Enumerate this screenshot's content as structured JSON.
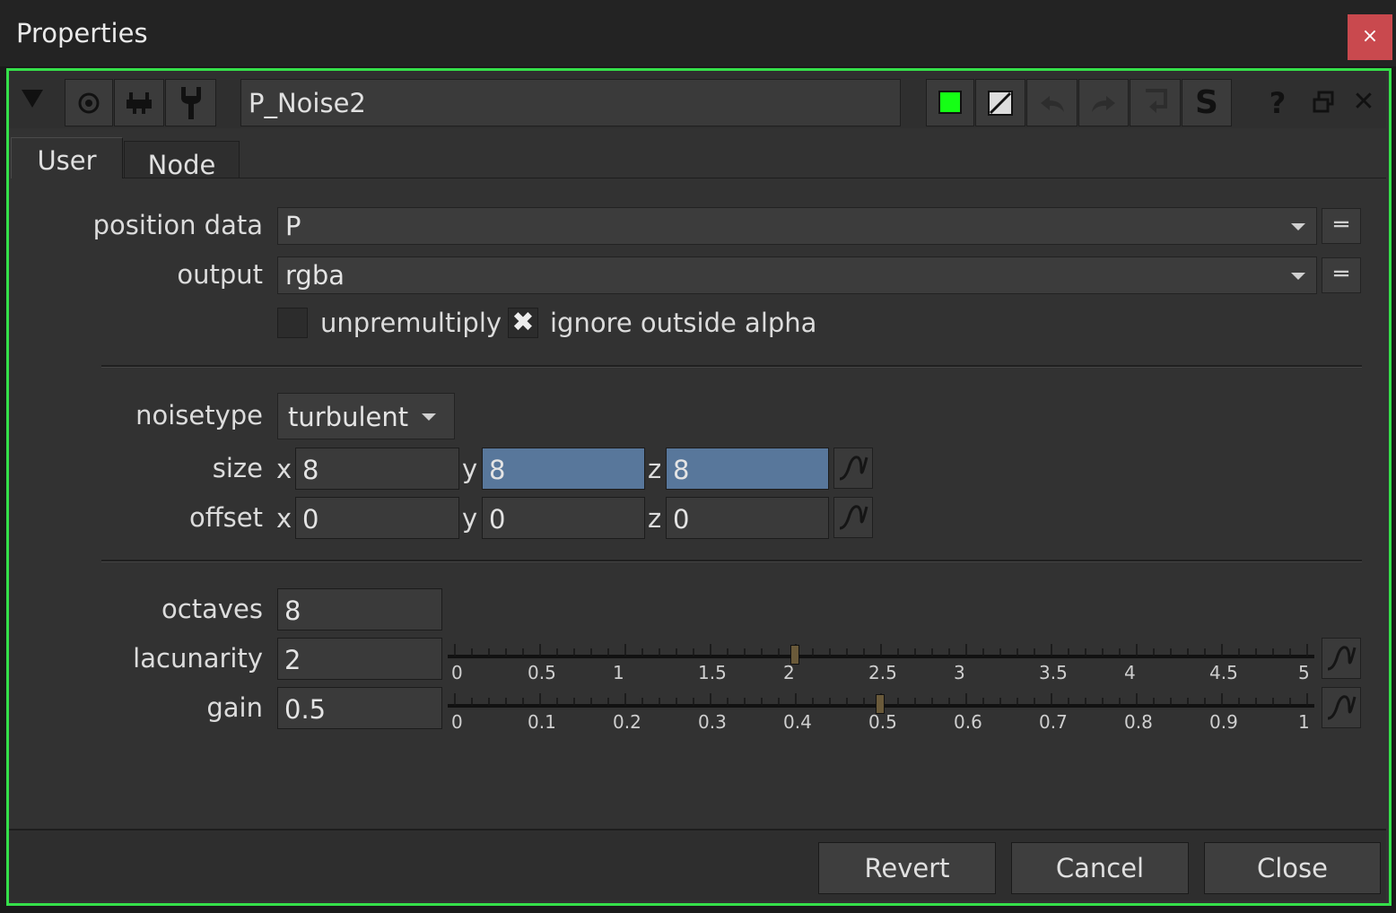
{
  "window": {
    "title": "Properties",
    "close_glyph": "×"
  },
  "toolbar": {
    "node_name": "P_Noise2",
    "icons": [
      "collapse-arrow-icon",
      "viewer-icon",
      "knob-icon",
      "wrench-icon",
      "green-color-swatch",
      "diagonal-swatch-icon",
      "undo-icon",
      "redo-icon",
      "revert-icon",
      "s-icon",
      "help-icon",
      "float-icon",
      "close-icon"
    ],
    "node_color": "#15ff15",
    "help_glyph": "?",
    "close_glyph": "✕",
    "s_glyph": "S"
  },
  "tabs": [
    {
      "label": "User"
    },
    {
      "label": "Node"
    }
  ],
  "form": {
    "position_data": {
      "label": "position data",
      "value": "P"
    },
    "output": {
      "label": "output",
      "value": "rgba"
    },
    "eq_glyph": "═",
    "unpremultiply": {
      "label": "unpremultiply",
      "checked": false
    },
    "ignore_outside_alpha": {
      "label": "ignore outside alpha",
      "checked": true,
      "glyph": "✖"
    },
    "noisetype": {
      "label": "noisetype",
      "value": "turbulent"
    },
    "size": {
      "label": "size",
      "x_label": "x",
      "y_label": "y",
      "z_label": "z",
      "x": "8",
      "y": "8",
      "z": "8"
    },
    "offset": {
      "label": "offset",
      "x_label": "x",
      "y_label": "y",
      "z_label": "z",
      "x": "0",
      "y": "0",
      "z": "0"
    },
    "octaves": {
      "label": "octaves",
      "value": "8"
    },
    "lacunarity": {
      "label": "lacunarity",
      "value": "2",
      "slider_value": 2,
      "range": [
        0,
        5
      ],
      "ticks": [
        "0",
        "0.5",
        "1",
        "1.5",
        "2",
        "2.5",
        "3",
        "3.5",
        "4",
        "4.5",
        "5"
      ]
    },
    "gain": {
      "label": "gain",
      "value": "0.5",
      "slider_value": 0.5,
      "range": [
        0,
        1
      ],
      "ticks": [
        "0",
        "0.1",
        "0.2",
        "0.3",
        "0.4",
        "0.5",
        "0.6",
        "0.7",
        "0.8",
        "0.9",
        "1"
      ]
    }
  },
  "buttons": {
    "revert": "Revert",
    "cancel": "Cancel",
    "close": "Close"
  },
  "colors": {
    "frame": "#35e04a",
    "close_bg": "#c9494e",
    "selected_field": "#58779b"
  }
}
